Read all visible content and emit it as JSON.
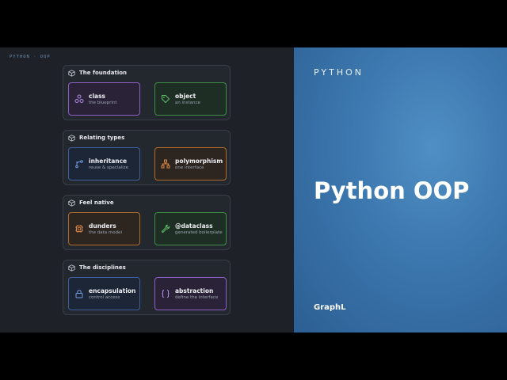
{
  "crumb": "PYTHON · OOP",
  "groups": [
    {
      "title": "The foundation",
      "cards": [
        {
          "title": "class",
          "subtitle": "the blueprint",
          "icon": "atom-icon",
          "accent": "#8b5fc4"
        },
        {
          "title": "object",
          "subtitle": "an instance",
          "icon": "tag-icon",
          "accent": "#3f8c48"
        }
      ]
    },
    {
      "title": "Relating types",
      "cards": [
        {
          "title": "inheritance",
          "subtitle": "reuse & specialize",
          "icon": "git-branch-icon",
          "accent": "#3e5f9c"
        },
        {
          "title": "polymorphism",
          "subtitle": "one interface",
          "icon": "hierarchy-icon",
          "accent": "#b06a2c"
        }
      ]
    },
    {
      "title": "Feel native",
      "cards": [
        {
          "title": "dunders",
          "subtitle": "the data model",
          "icon": "chip-icon",
          "accent": "#b06a2c"
        },
        {
          "title": "@dataclass",
          "subtitle": "generated boilerplate",
          "icon": "wrench-icon",
          "accent": "#3f8c48"
        }
      ]
    },
    {
      "title": "The disciplines",
      "cards": [
        {
          "title": "encapsulation",
          "subtitle": "control access",
          "icon": "lock-icon",
          "accent": "#3e5f9c"
        },
        {
          "title": "abstraction",
          "subtitle": "define the interface",
          "icon": "braces-icon",
          "accent": "#8b5fc4"
        }
      ]
    }
  ],
  "hero": {
    "kicker": "PYTHON",
    "title": "Python OOP",
    "brand": "GraphL"
  },
  "colors": {
    "left_bg": "#1e2127",
    "right_bg": "#3b76ad",
    "purple": "#8b5fc4",
    "green": "#3f8c48",
    "blue": "#3e5f9c",
    "orange": "#b06a2c"
  }
}
